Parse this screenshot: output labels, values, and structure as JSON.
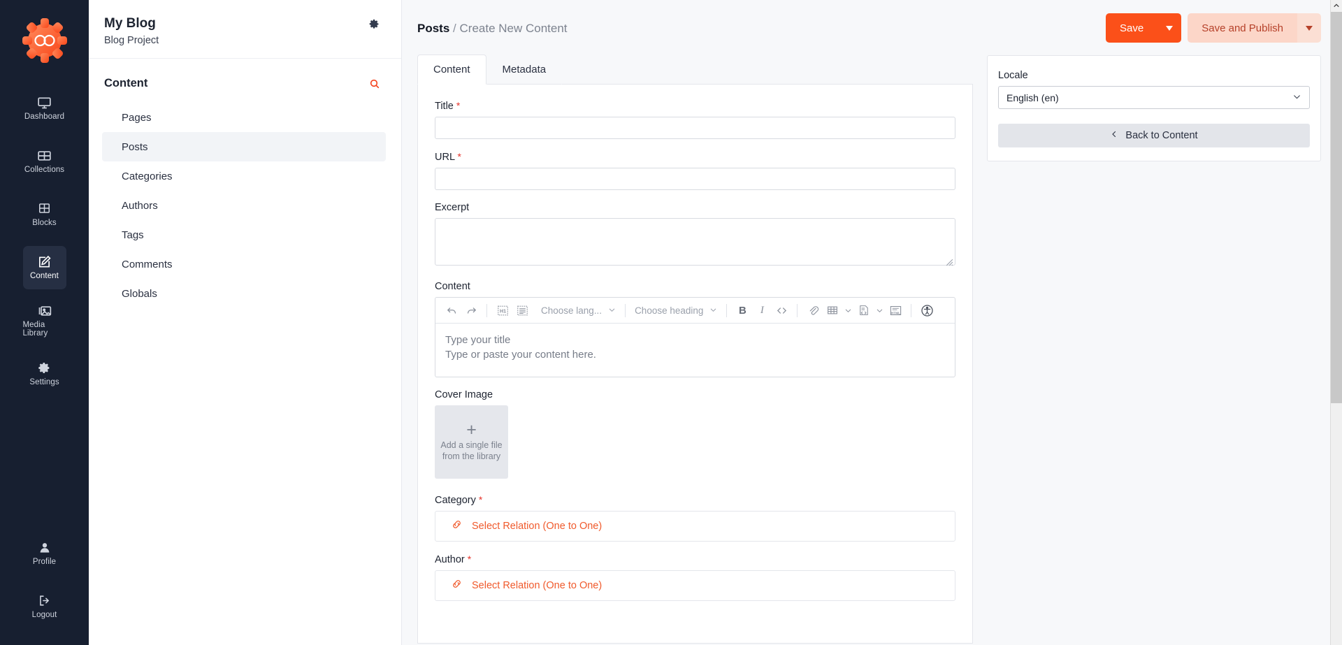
{
  "primary_nav": {
    "logo_name": "infinity-gear-logo",
    "items": [
      {
        "label": "Dashboard",
        "icon": "monitor-icon",
        "active": false
      },
      {
        "label": "Collections",
        "icon": "collections-grid-icon",
        "active": false
      },
      {
        "label": "Blocks",
        "icon": "blocks-grid-icon",
        "active": false
      },
      {
        "label": "Content",
        "icon": "pencil-square-icon",
        "active": true
      },
      {
        "label": "Media Library",
        "icon": "image-library-icon",
        "active": false
      },
      {
        "label": "Settings",
        "icon": "gear-icon",
        "active": false
      }
    ],
    "bottom_items": [
      {
        "label": "Profile",
        "icon": "user-icon"
      },
      {
        "label": "Logout",
        "icon": "logout-arrow-icon"
      }
    ]
  },
  "sidebar": {
    "title": "My Blog",
    "subtitle": "Blog Project",
    "gear_icon": "gear-icon",
    "section_title": "Content",
    "search_icon": "search-icon",
    "items": [
      {
        "label": "Pages",
        "active": false
      },
      {
        "label": "Posts",
        "active": true
      },
      {
        "label": "Categories",
        "active": false
      },
      {
        "label": "Authors",
        "active": false
      },
      {
        "label": "Tags",
        "active": false
      },
      {
        "label": "Comments",
        "active": false
      },
      {
        "label": "Globals",
        "active": false
      }
    ]
  },
  "header": {
    "breadcrumb_current": "Posts",
    "breadcrumb_separator": "/",
    "breadcrumb_page": "Create New Content",
    "save_label": "Save",
    "save_publish_label": "Save and Publish",
    "accent_color": "#fb5019",
    "soft_accent_color": "#fcd6c8"
  },
  "tabs": [
    {
      "label": "Content",
      "active": true
    },
    {
      "label": "Metadata",
      "active": false
    }
  ],
  "form": {
    "title": {
      "label": "Title",
      "required": "*",
      "value": "",
      "placeholder": ""
    },
    "url": {
      "label": "URL",
      "required": "*",
      "value": "",
      "placeholder": ""
    },
    "excerpt": {
      "label": "Excerpt",
      "value": "",
      "placeholder": ""
    },
    "content": {
      "label": "Content",
      "toolbar": {
        "undo_icon": "undo-arrow-icon",
        "redo_icon": "redo-arrow-icon",
        "heading_block_icon": "h1-block-icon",
        "text_block_icon": "paragraph-block-icon",
        "language_select": "Choose lang...",
        "heading_select": "Choose heading",
        "bold": "B",
        "italic": "I",
        "code_icon": "inline-code-icon",
        "link_icon": "link-paperclip-icon",
        "table_icon": "table-icon",
        "code_block_icon": "code-block-icon",
        "html_icon": "html-embed-icon",
        "accessibility_icon": "accessibility-icon"
      },
      "placeholder_title": "Type your title",
      "placeholder_body": "Type or paste your content here."
    },
    "cover_image": {
      "label": "Cover Image",
      "plus_icon": "plus-icon",
      "text_line1": "Add a single file",
      "text_line2": "from the library"
    },
    "category": {
      "label": "Category",
      "required": "*",
      "link_icon": "chain-link-icon",
      "action_text": "Select Relation (One to One)"
    },
    "author": {
      "label": "Author",
      "required": "*",
      "link_icon": "chain-link-icon",
      "action_text": "Select Relation (One to One)"
    }
  },
  "side_panel": {
    "locale_label": "Locale",
    "locale_value": "English (en)",
    "locale_chevron_icon": "chevron-down-icon",
    "back_label": "Back to Content",
    "back_chevron_icon": "chevron-left-icon"
  },
  "scrollbar": {
    "up_arrow_icon": "chevron-up-icon"
  }
}
